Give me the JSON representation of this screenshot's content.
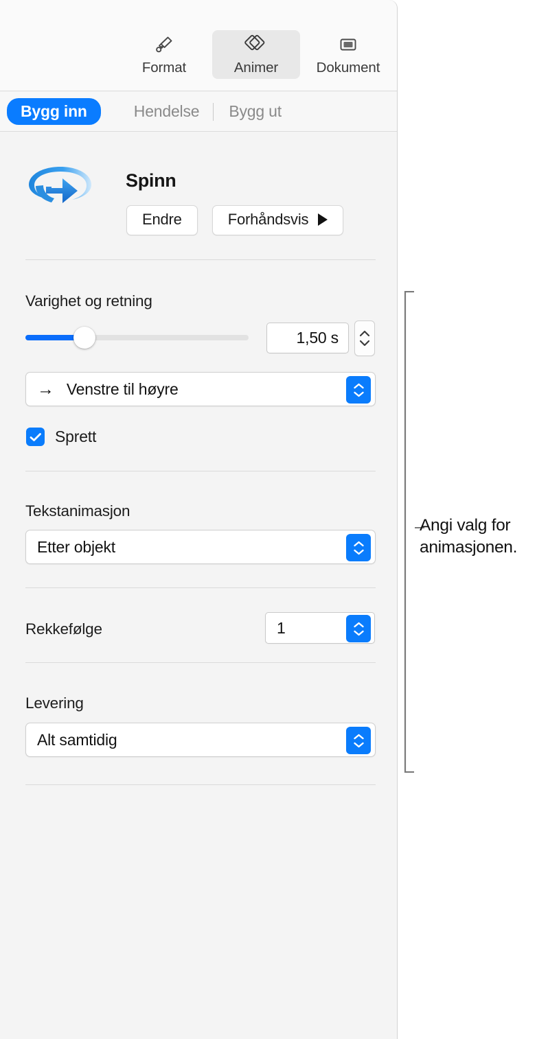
{
  "toolbar": {
    "items": [
      {
        "label": "Format",
        "icon": "paintbrush-icon",
        "selected": false
      },
      {
        "label": "Animer",
        "icon": "animate-diamonds-icon",
        "selected": true
      },
      {
        "label": "Dokument",
        "icon": "document-icon",
        "selected": false
      }
    ]
  },
  "tabs": [
    {
      "label": "Bygg inn",
      "active": true
    },
    {
      "label": "Hendelse",
      "active": false
    },
    {
      "label": "Bygg ut",
      "active": false
    }
  ],
  "animation": {
    "name": "Spinn",
    "icon": "spin-arrow-icon",
    "change_button": "Endre",
    "preview_button": "Forhåndsvis",
    "preview_icon": "play-triangle-icon"
  },
  "duration": {
    "label": "Varighet og retning",
    "value": "1,50 s",
    "slider_percent": 26,
    "stepper_icon": "up-down-chevron-icon",
    "direction": {
      "arrow_glyph": "→",
      "value": "Venstre til høyre",
      "menu_icon": "up-down-chevron-icon"
    },
    "bounce": {
      "label": "Sprett",
      "checked": true,
      "icon": "checkmark-icon"
    }
  },
  "text_animation": {
    "label": "Tekstanimasjon",
    "value": "Etter objekt",
    "menu_icon": "up-down-chevron-icon"
  },
  "order": {
    "label": "Rekkefølge",
    "value": "1",
    "menu_icon": "up-down-chevron-icon"
  },
  "delivery": {
    "label": "Levering",
    "value": "Alt samtidig",
    "menu_icon": "up-down-chevron-icon"
  },
  "callout": {
    "text": "Angi valg for animasjonen."
  },
  "colors": {
    "accent_blue": "#0a7cfc",
    "panel_bg": "#f4f4f4",
    "toolbar_bg": "#fafafa",
    "callout_line": "#7a7a7a"
  }
}
